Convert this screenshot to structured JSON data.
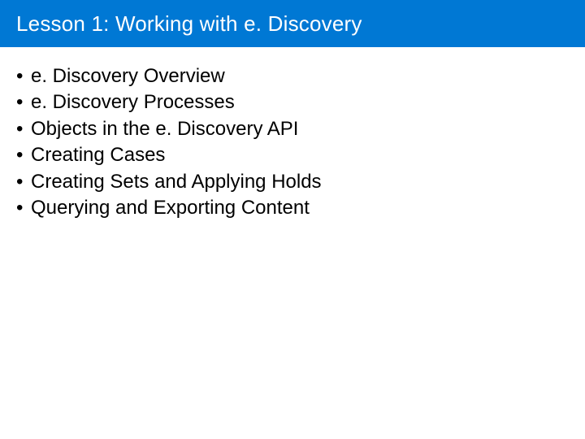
{
  "header": {
    "title": "Lesson 1: Working with e. Discovery"
  },
  "bullets": {
    "items": [
      "e. Discovery Overview",
      "e. Discovery Processes",
      "Objects in the e. Discovery API",
      "Creating Cases",
      "Creating Sets and Applying Holds",
      "Querying and Exporting Content"
    ]
  }
}
